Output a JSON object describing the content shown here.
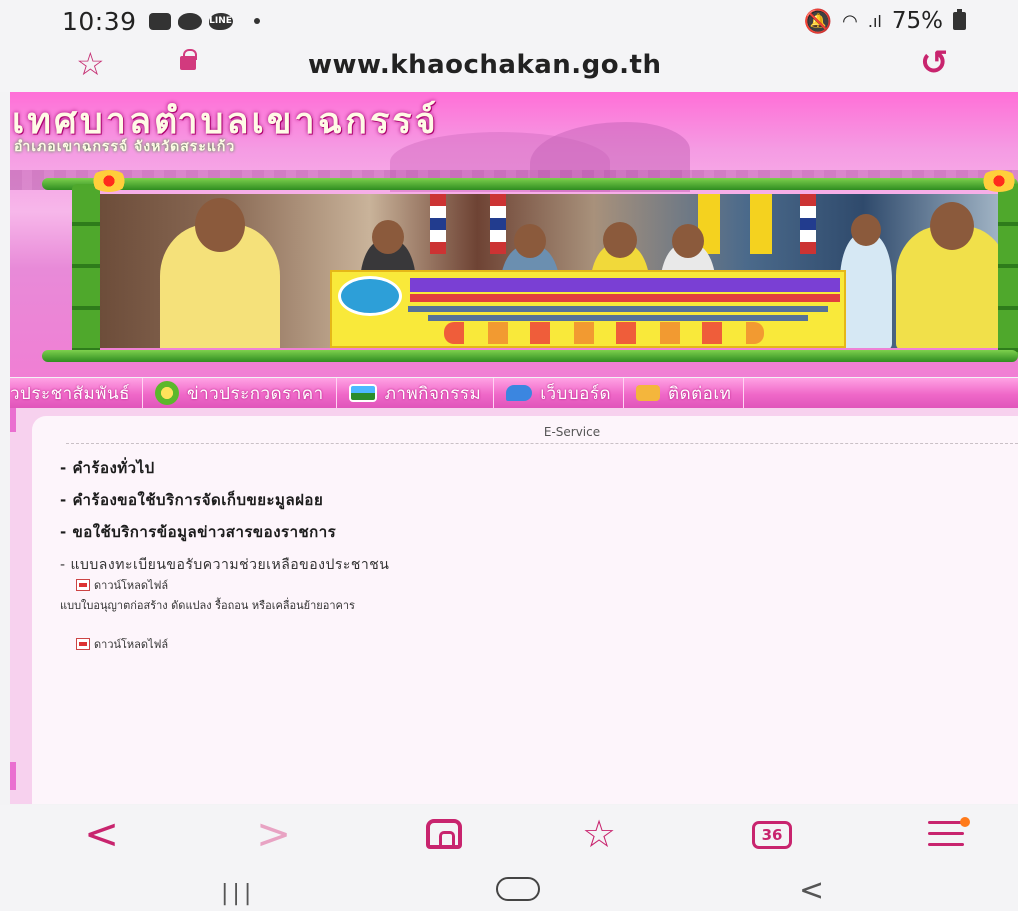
{
  "status_bar": {
    "time": "10:39",
    "left_icons": [
      "gallery-icon",
      "messenger-icon",
      "line-icon",
      "notification-dot"
    ],
    "line_label": "LINE",
    "battery": "75%",
    "right_icons": [
      "mute-icon",
      "wifi-icon",
      "signal-icon",
      "battery-icon"
    ]
  },
  "address_bar": {
    "url": "www.khaochakan.go.th",
    "star_glyph": "☆",
    "reload_glyph": "↺"
  },
  "banner": {
    "title": "เทศบาลตำบลเขาฉกรรจ์",
    "subtitle": "อำเภอเขาฉกรรจ์  จังหวัดสระแก้ว"
  },
  "nav": {
    "items": [
      {
        "label": "วประชาสัมพันธ์",
        "icon": ""
      },
      {
        "label": "ข่าวประกวดราคา",
        "icon": "money-icon"
      },
      {
        "label": "ภาพกิจกรรม",
        "icon": "photo-icon"
      },
      {
        "label": "เว็บบอร์ด",
        "icon": "chat-icon"
      },
      {
        "label": "ติดต่อเท",
        "icon": "mail-icon"
      }
    ]
  },
  "content": {
    "header": "E-Service",
    "services": [
      "- คำร้องทั่วไป",
      "- คำร้องขอใช้บริการจัดเก็บขยะมูลฝอย",
      "- ขอใช้บริการข้อมูลข่าวสารของราชการ"
    ],
    "form_item": "- แบบลงทะเบียนขอรับความช่วยเหลือของประชาชน",
    "download_label_1": "ดาวน์โหลดไฟล์",
    "note": "แบบใบอนุญาตก่อสร้าง ดัดแปลง รื้อถอน หรือเคลื่อนย้ายอาคาร",
    "download_label_2": "ดาวน์โหลดไฟล์"
  },
  "toolbar": {
    "back": "<",
    "forward": ">",
    "bookmarks": "☆",
    "tabs_count": "36",
    "icons": [
      "back-icon",
      "forward-icon",
      "home-icon",
      "bookmarks-icon",
      "tabs-icon",
      "menu-icon"
    ]
  },
  "android_nav": {
    "recent": "|||",
    "back": "<"
  }
}
